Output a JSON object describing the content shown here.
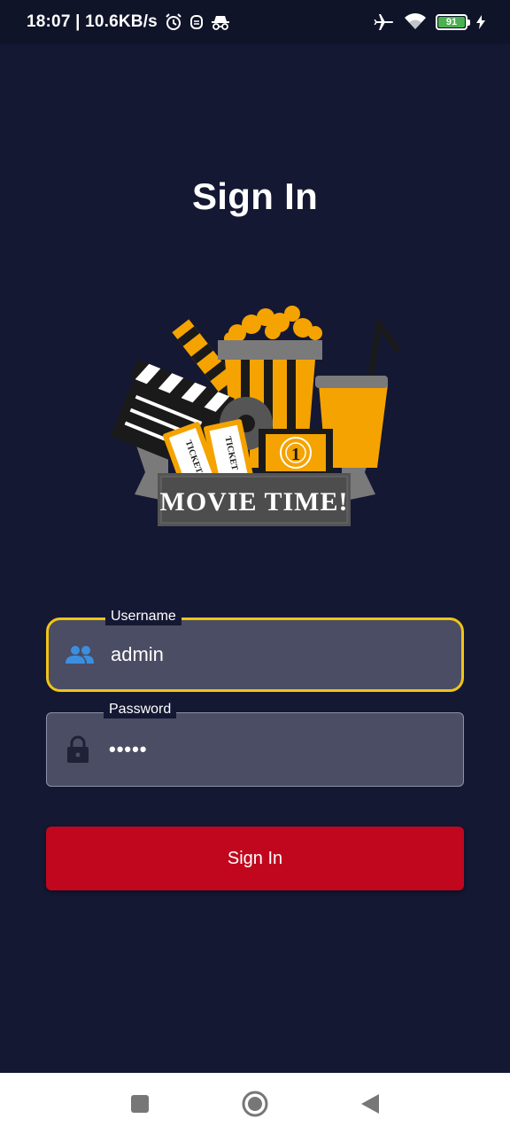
{
  "status_bar": {
    "time_speed": "18:07 | 10.6KB/s",
    "battery_level": "91",
    "icons": [
      "alarm-icon",
      "notification-icon",
      "incognito-icon",
      "airplane-mode-icon",
      "wifi-icon",
      "battery-icon",
      "charging-icon"
    ]
  },
  "page": {
    "title": "Sign In"
  },
  "logo": {
    "text": "MOVIE TIME!",
    "ticket_text": "TICKET",
    "countdown_number": "1"
  },
  "form": {
    "username": {
      "label": "Username",
      "value": "admin",
      "icon": "people-icon"
    },
    "password": {
      "label": "Password",
      "value": "•••••",
      "icon": "lock-icon"
    },
    "submit_label": "Sign In"
  },
  "nav_bar": {
    "buttons": [
      "recent-apps-icon",
      "home-icon",
      "back-icon"
    ]
  },
  "colors": {
    "background": "#141833",
    "field_background": "#4a4d63",
    "focus_border": "#f0c419",
    "button": "#c0071e",
    "logo_orange": "#f5a300",
    "people_icon": "#3b8fe0"
  }
}
